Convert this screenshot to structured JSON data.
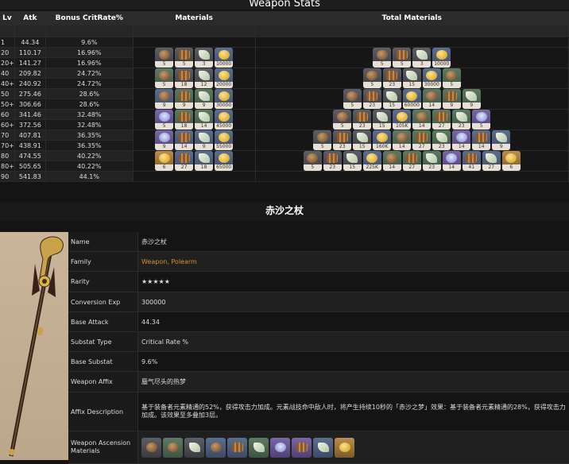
{
  "page": {
    "title": "Weapon Stats",
    "weapon_title": "赤沙之杖"
  },
  "table": {
    "headers": {
      "lv": "Lv",
      "atk": "Atk",
      "crit": "Bonus CritRate%",
      "materials": "Materials",
      "total": "Total Materials"
    },
    "rows": [
      {
        "lv": "1",
        "atk": "44.34",
        "crit": "9.6%"
      },
      {
        "lv": "20",
        "atk": "110.17",
        "crit": "16.96%"
      },
      {
        "lv": "20+",
        "atk": "141.27",
        "crit": "16.96%"
      },
      {
        "lv": "40",
        "atk": "209.82",
        "crit": "24.72%"
      },
      {
        "lv": "40+",
        "atk": "240.92",
        "crit": "24.72%"
      },
      {
        "lv": "50",
        "atk": "275.46",
        "crit": "28.6%"
      },
      {
        "lv": "50+",
        "atk": "306.66",
        "crit": "28.6%"
      },
      {
        "lv": "60",
        "atk": "341.46",
        "crit": "32.48%"
      },
      {
        "lv": "60+",
        "atk": "372.56",
        "crit": "32.48%"
      },
      {
        "lv": "70",
        "atk": "407.81",
        "crit": "36.35%"
      },
      {
        "lv": "70+",
        "atk": "438.91",
        "crit": "36.35%"
      },
      {
        "lv": "80",
        "atk": "474.55",
        "crit": "40.22%"
      },
      {
        "lv": "80+",
        "atk": "505.65",
        "crit": "40.22%"
      },
      {
        "lv": "90",
        "atk": "541.83",
        "crit": "44.1%"
      }
    ],
    "materials": [
      [
        {
          "icon": "brown-orb-icon",
          "n": "5",
          "q": "grey"
        },
        {
          "icon": "barrel-icon",
          "n": "5",
          "q": "grey"
        },
        {
          "icon": "leaf-icon",
          "n": "3",
          "q": "grey"
        },
        {
          "icon": "mora-coin-icon",
          "n": "10000",
          "q": "blue"
        }
      ],
      [
        {
          "icon": "brown-orb-icon",
          "n": "5",
          "q": "green"
        },
        {
          "icon": "barrel-icon",
          "n": "18",
          "q": "grey"
        },
        {
          "icon": "leaf-icon",
          "n": "12",
          "q": "grey"
        },
        {
          "icon": "mora-coin-icon",
          "n": "20000",
          "q": "blue"
        }
      ],
      [
        {
          "icon": "brown-orb-icon",
          "n": "9",
          "q": "blue"
        },
        {
          "icon": "barrel-icon",
          "n": "9",
          "q": "green"
        },
        {
          "icon": "leaf-icon",
          "n": "9",
          "q": "green"
        },
        {
          "icon": "mora-coin-icon",
          "n": "30000",
          "q": "blue"
        }
      ],
      [
        {
          "icon": "mask-icon",
          "n": "5",
          "q": "purple"
        },
        {
          "icon": "barrel-icon",
          "n": "18",
          "q": "green"
        },
        {
          "icon": "leaf-icon",
          "n": "14",
          "q": "green"
        },
        {
          "icon": "mora-coin-icon",
          "n": "45000",
          "q": "blue"
        }
      ],
      [
        {
          "icon": "mask-icon",
          "n": "9",
          "q": "purple"
        },
        {
          "icon": "barrel-icon",
          "n": "14",
          "q": "blue"
        },
        {
          "icon": "leaf-icon",
          "n": "9",
          "q": "blue"
        },
        {
          "icon": "mora-coin-icon",
          "n": "55000",
          "q": "blue"
        }
      ],
      [
        {
          "icon": "gold-orb-icon",
          "n": "6",
          "q": "gold"
        },
        {
          "icon": "barrel-icon",
          "n": "27",
          "q": "blue"
        },
        {
          "icon": "leaf-icon",
          "n": "18",
          "q": "blue"
        },
        {
          "icon": "mora-coin-icon",
          "n": "65000",
          "q": "blue"
        }
      ]
    ],
    "totals": [
      [
        {
          "icon": "brown-orb-icon",
          "n": "5",
          "q": "grey"
        },
        {
          "icon": "barrel-icon",
          "n": "5",
          "q": "grey"
        },
        {
          "icon": "leaf-icon",
          "n": "3",
          "q": "grey"
        },
        {
          "icon": "mora-coin-icon",
          "n": "10000",
          "q": "blue"
        }
      ],
      [
        {
          "icon": "brown-orb-icon",
          "n": "5",
          "q": "grey"
        },
        {
          "icon": "barrel-icon",
          "n": "23",
          "q": "grey"
        },
        {
          "icon": "leaf-icon",
          "n": "15",
          "q": "grey"
        },
        {
          "icon": "mora-coin-icon",
          "n": "30000",
          "q": "blue"
        },
        {
          "icon": "brown-orb-icon",
          "n": "5",
          "q": "green"
        }
      ],
      [
        {
          "icon": "brown-orb-icon",
          "n": "5",
          "q": "grey"
        },
        {
          "icon": "barrel-icon",
          "n": "23",
          "q": "grey"
        },
        {
          "icon": "leaf-icon",
          "n": "15",
          "q": "grey"
        },
        {
          "icon": "mora-coin-icon",
          "n": "60000",
          "q": "blue"
        },
        {
          "icon": "brown-orb-icon",
          "n": "14",
          "q": "green"
        },
        {
          "icon": "barrel-icon",
          "n": "9",
          "q": "green"
        },
        {
          "icon": "leaf-icon",
          "n": "9",
          "q": "green"
        }
      ],
      [
        {
          "icon": "brown-orb-icon",
          "n": "5",
          "q": "grey"
        },
        {
          "icon": "barrel-icon",
          "n": "23",
          "q": "grey"
        },
        {
          "icon": "leaf-icon",
          "n": "15",
          "q": "grey"
        },
        {
          "icon": "mora-coin-icon",
          "n": "105K",
          "q": "blue"
        },
        {
          "icon": "brown-orb-icon",
          "n": "14",
          "q": "green"
        },
        {
          "icon": "barrel-icon",
          "n": "27",
          "q": "green"
        },
        {
          "icon": "leaf-icon",
          "n": "23",
          "q": "green"
        },
        {
          "icon": "mask-icon",
          "n": "5",
          "q": "purple"
        }
      ],
      [
        {
          "icon": "brown-orb-icon",
          "n": "5",
          "q": "grey"
        },
        {
          "icon": "barrel-icon",
          "n": "23",
          "q": "grey"
        },
        {
          "icon": "leaf-icon",
          "n": "15",
          "q": "grey"
        },
        {
          "icon": "mora-coin-icon",
          "n": "160K",
          "q": "blue"
        },
        {
          "icon": "brown-orb-icon",
          "n": "14",
          "q": "green"
        },
        {
          "icon": "barrel-icon",
          "n": "27",
          "q": "green"
        },
        {
          "icon": "leaf-icon",
          "n": "23",
          "q": "green"
        },
        {
          "icon": "mask-icon",
          "n": "14",
          "q": "purple"
        },
        {
          "icon": "barrel-icon",
          "n": "14",
          "q": "blue"
        },
        {
          "icon": "leaf-icon",
          "n": "9",
          "q": "blue"
        }
      ],
      [
        {
          "icon": "brown-orb-icon",
          "n": "5",
          "q": "grey"
        },
        {
          "icon": "barrel-icon",
          "n": "23",
          "q": "grey"
        },
        {
          "icon": "leaf-icon",
          "n": "15",
          "q": "grey"
        },
        {
          "icon": "mora-coin-icon",
          "n": "225K",
          "q": "blue"
        },
        {
          "icon": "brown-orb-icon",
          "n": "14",
          "q": "green"
        },
        {
          "icon": "barrel-icon",
          "n": "27",
          "q": "green"
        },
        {
          "icon": "leaf-icon",
          "n": "23",
          "q": "green"
        },
        {
          "icon": "mask-icon",
          "n": "14",
          "q": "purple"
        },
        {
          "icon": "barrel-icon",
          "n": "41",
          "q": "blue"
        },
        {
          "icon": "leaf-icon",
          "n": "27",
          "q": "blue"
        },
        {
          "icon": "gold-orb-icon",
          "n": "6",
          "q": "gold"
        }
      ]
    ]
  },
  "info": {
    "name_label": "Name",
    "name_value": "赤沙之杖",
    "family_label": "Family",
    "family_value": "Weapon, Polearm",
    "rarity_label": "Rarity",
    "rarity_stars": 5,
    "rarity_value": "★★★★★",
    "exp_label": "Conversion Exp",
    "exp_value": "300000",
    "base_label": "Base Attack",
    "base_value": "44.34",
    "substat_type_label": "Substat Type",
    "substat_type_value": "Critical Rate %",
    "base_substat_label": "Base Substat",
    "base_substat_value": "9.6%",
    "affix_label": "Weapon Affix",
    "affix_value": "蜃气尽头的热梦",
    "affix_desc_label": "Affix Description",
    "affix_desc_value": "基于装备者元素精通的52%，获得攻击力加成。元素战技命中敌人时，将产生持续10秒的「赤沙之梦」效果：基于装备者元素精通的28%，获得攻击力加成。该效果至多叠加3层。",
    "ascension_label": "Weapon Ascension Materials"
  },
  "ascension_icons": [
    {
      "icon": "brown-orb-icon",
      "q": "grey"
    },
    {
      "icon": "brown-orb-icon",
      "q": "green"
    },
    {
      "icon": "leaf-icon",
      "q": "grey"
    },
    {
      "icon": "brown-orb-icon",
      "q": "blue"
    },
    {
      "icon": "barrel-icon",
      "q": "blue"
    },
    {
      "icon": "leaf-icon",
      "q": "green"
    },
    {
      "icon": "mask-icon",
      "q": "purple"
    },
    {
      "icon": "barrel-icon",
      "q": "purple"
    },
    {
      "icon": "leaf-icon",
      "q": "blue"
    },
    {
      "icon": "gold-orb-icon",
      "q": "gold"
    }
  ]
}
